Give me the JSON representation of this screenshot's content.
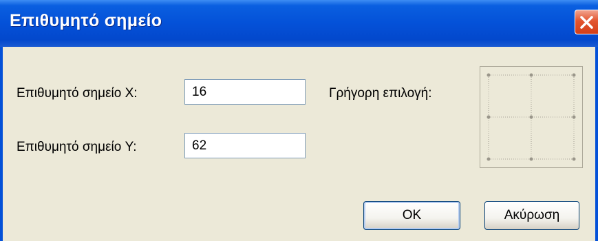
{
  "window": {
    "title": "Επιθυμητό σημείο"
  },
  "form": {
    "x_label": "Επιθυμητό σημείο X:",
    "x_value": "16",
    "y_label": "Επιθυμητό σημείο Y:",
    "y_value": "62",
    "quick_label": "Γρήγορη επιλογή:"
  },
  "buttons": {
    "ok": "OK",
    "cancel": "Ακύρωση"
  },
  "icons": {
    "close": "close-icon"
  },
  "colors": {
    "titlebar": "#0451D8",
    "background": "#ECE9D8",
    "close_button": "#D43F18"
  }
}
